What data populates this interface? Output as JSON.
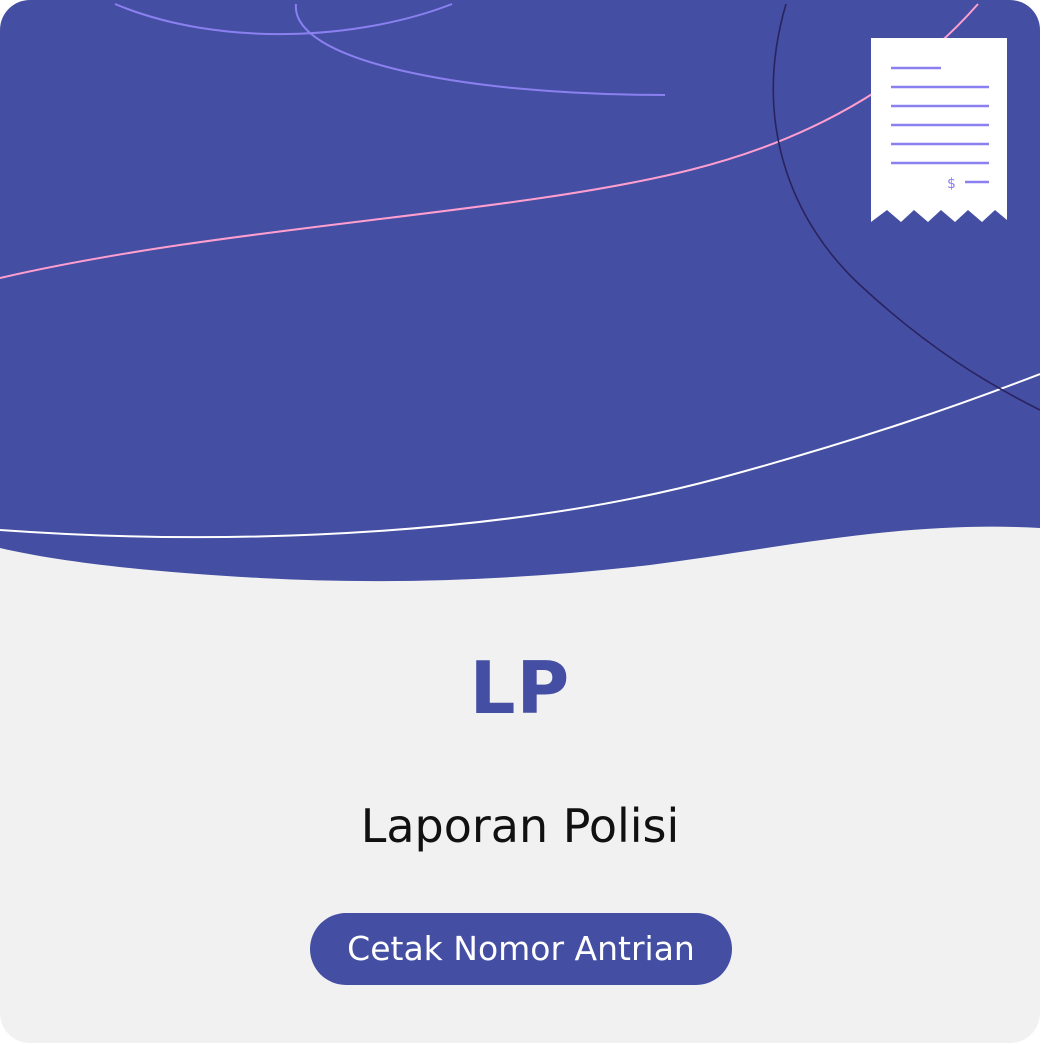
{
  "card": {
    "code": "LP",
    "service_name": "Laporan Polisi",
    "button_label": "Cetak Nomor Antrian"
  },
  "receipt_icon": {
    "symbol": "$"
  },
  "colors": {
    "primary": "#444ea2",
    "background": "#f1f1f1",
    "text": "#111111",
    "button_text": "#ffffff",
    "accent_line": "#ff9fcf",
    "receipt_lines": "#8a80f0"
  }
}
